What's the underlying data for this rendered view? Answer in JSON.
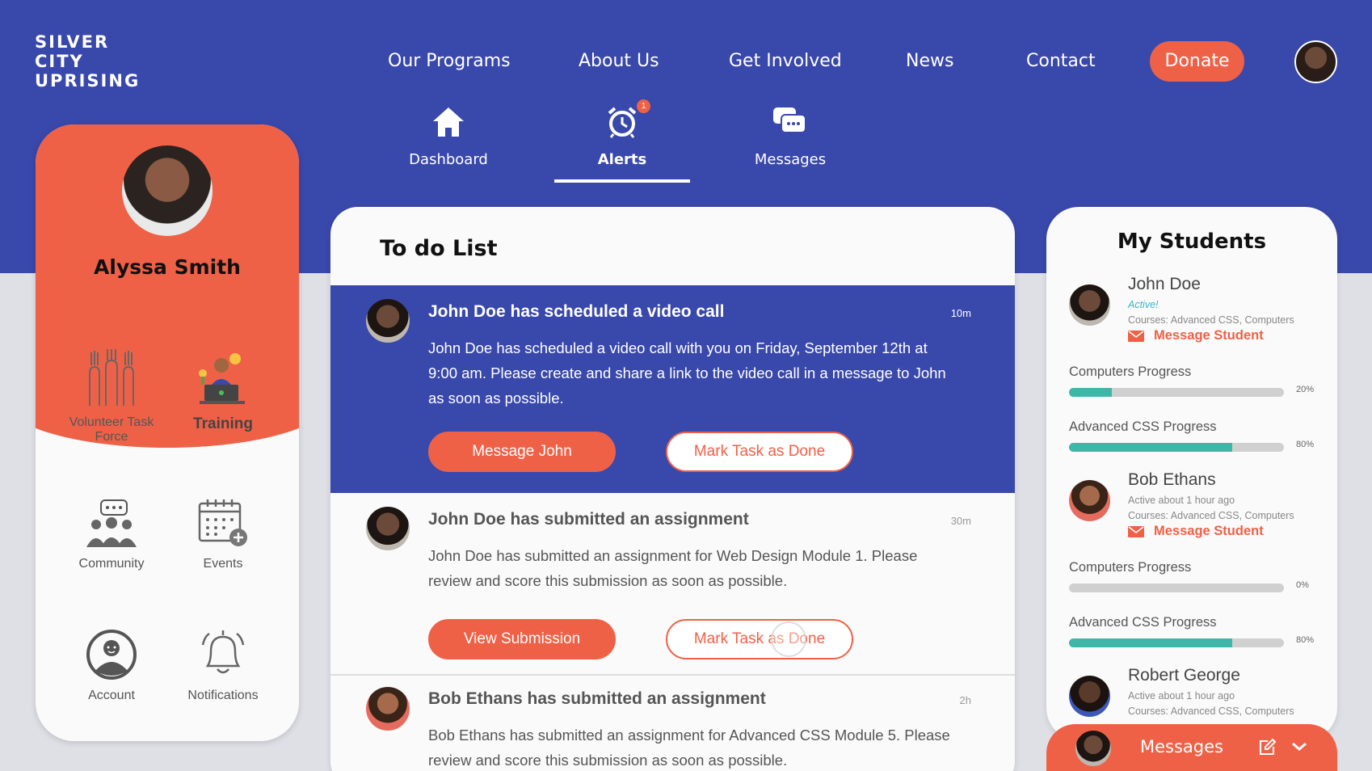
{
  "brand": {
    "logo_lines": [
      "SILVER",
      "CITY",
      "UPRISING"
    ]
  },
  "topnav": {
    "items": [
      "Our Programs",
      "About Us",
      "Get Involved",
      "News",
      "Contact"
    ],
    "donate": "Donate"
  },
  "subnav": {
    "dashboard": "Dashboard",
    "alerts": "Alerts",
    "messages": "Messages",
    "alerts_badge": "1"
  },
  "profile": {
    "name": "Alyssa Smith",
    "tiles": {
      "volunteer": "Volunteer Task Force",
      "training": "Training",
      "community": "Community",
      "events": "Events",
      "account": "Account",
      "notifications": "Notifications"
    }
  },
  "todo": {
    "title": "To do List",
    "tasks": [
      {
        "title": "John Doe has scheduled a video call",
        "time": "10m",
        "body": "John Doe has scheduled a video call with you on Friday, September 12th at 9:00 am. Please create and share a link to the video call in a message to John as soon as possible.",
        "primary": "Message John",
        "secondary": "Mark Task as Done"
      },
      {
        "title": "John Doe has submitted an assignment",
        "time": "30m",
        "body": "John Doe has submitted an assignment for Web Design Module 1. Please review and score this submission as soon as possible.",
        "primary": "View Submission",
        "secondary": "Mark Task as Done"
      },
      {
        "title": "Bob Ethans has submitted an assignment",
        "time": "2h",
        "body": "Bob Ethans has submitted an assignment for Advanced CSS  Module 5. Please review and score this submission as soon as possible."
      }
    ]
  },
  "students": {
    "title": "My Students",
    "list": [
      {
        "name": "John Doe",
        "status": "Active!",
        "courses": "Courses: Advanced CSS, Computers",
        "message": "Message Student",
        "progress": [
          {
            "label": "Computers Progress",
            "value": 20,
            "pct": "20%"
          },
          {
            "label": "Advanced CSS Progress",
            "value": 80,
            "pct": "80%"
          }
        ]
      },
      {
        "name": "Bob Ethans",
        "status": "Active about 1 hour ago",
        "courses": "Courses: Advanced CSS, Computers",
        "message": "Message Student",
        "progress": [
          {
            "label": "Computers Progress",
            "value": 0,
            "pct": "0%"
          },
          {
            "label": "Advanced CSS Progress",
            "value": 80,
            "pct": "80%"
          }
        ]
      },
      {
        "name": "Robert George",
        "status": "Active about 1 hour ago",
        "courses": "Courses: Advanced CSS, Computers"
      }
    ]
  },
  "messages_bar": {
    "label": "Messages"
  },
  "colors": {
    "primary_blue": "#3948ab",
    "accent_coral": "#ef6147",
    "progress_teal": "#3fb7a8",
    "active_cyan": "#39b5c9"
  }
}
